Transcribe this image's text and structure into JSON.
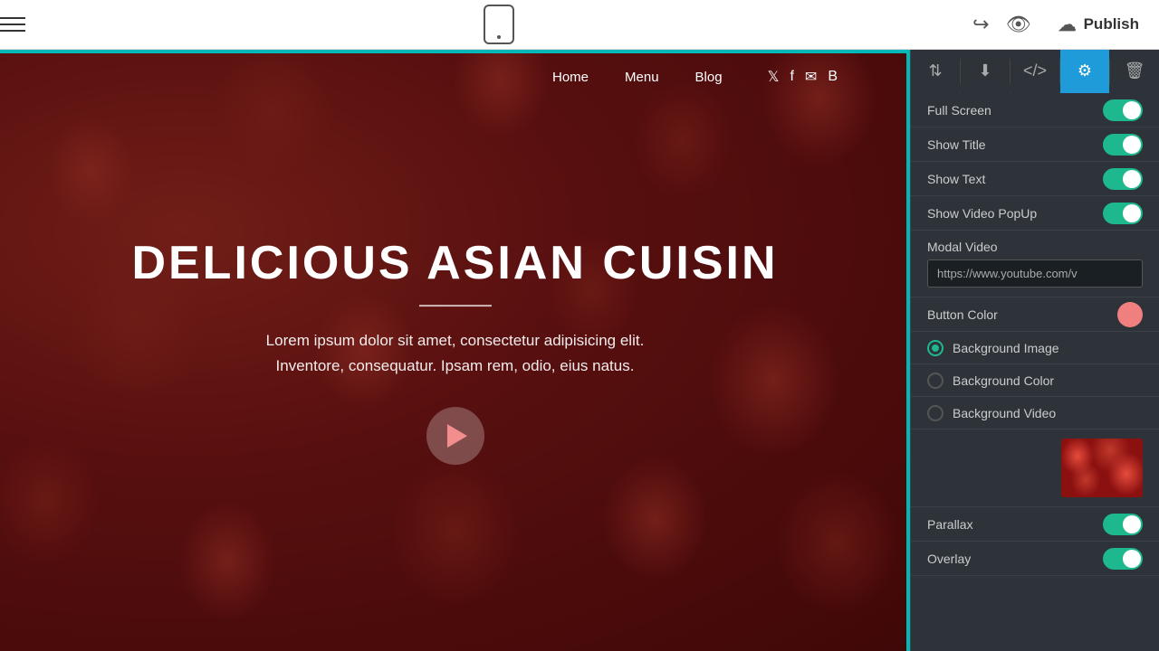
{
  "topbar": {
    "publish_label": "Publish"
  },
  "nav": {
    "items": [
      {
        "label": "Home"
      },
      {
        "label": "Menu"
      },
      {
        "label": "Blog"
      }
    ],
    "social_icons": [
      "twitter",
      "facebook",
      "email",
      "more"
    ]
  },
  "hero": {
    "title": "DELICIOUS ASIAN CUISIN",
    "body_line1": "Lorem ipsum dolor sit amet, consectetur adipisicing elit.",
    "body_line2": "Inventore, consequatur. Ipsam rem, odio, eius natus."
  },
  "panel": {
    "toolbar_icons": [
      {
        "name": "sort-icon",
        "symbol": "⇅"
      },
      {
        "name": "download-icon",
        "symbol": "↓"
      },
      {
        "name": "code-icon",
        "symbol": "</>"
      },
      {
        "name": "settings-icon",
        "symbol": "⚙"
      },
      {
        "name": "delete-icon",
        "symbol": "🗑"
      }
    ],
    "settings": {
      "full_screen": {
        "label": "Full Screen",
        "on": true
      },
      "show_title": {
        "label": "Show Title",
        "on": true
      },
      "show_text": {
        "label": "Show Text",
        "on": true
      },
      "show_video_popup": {
        "label": "Show Video PopUp",
        "on": true
      },
      "modal_video": {
        "label": "Modal Video",
        "placeholder": "https://www.youtube.com/v",
        "value": "https://www.youtube.com/v"
      },
      "button_color": {
        "label": "Button Color"
      },
      "background_image": {
        "label": "Background Image",
        "checked": true
      },
      "background_color": {
        "label": "Background Color",
        "checked": false
      },
      "background_video": {
        "label": "Background Video",
        "checked": false
      },
      "parallax": {
        "label": "Parallax",
        "on": true
      },
      "overlay": {
        "label": "Overlay",
        "on": true
      }
    }
  }
}
